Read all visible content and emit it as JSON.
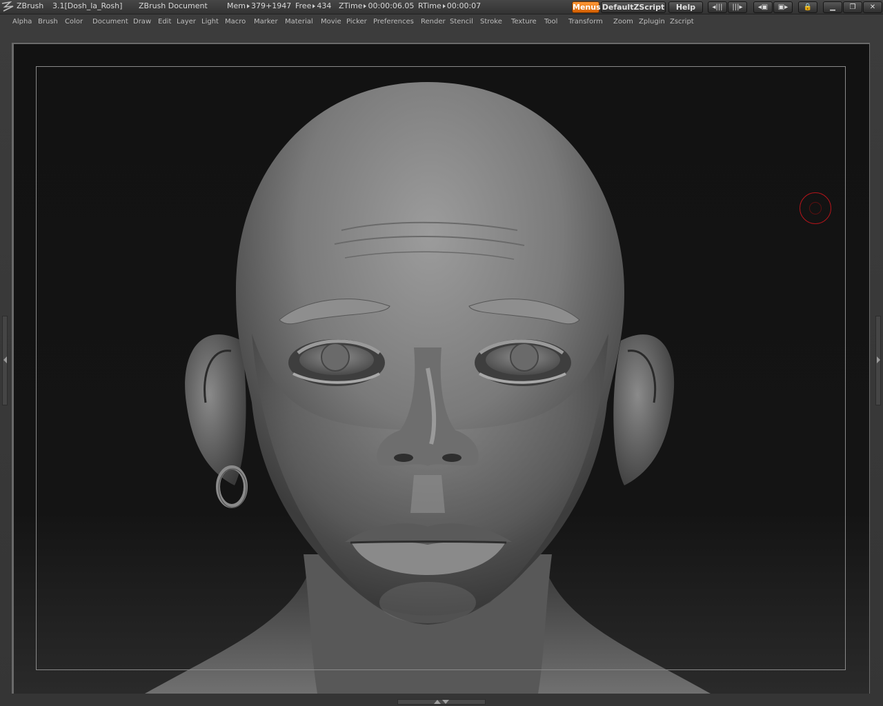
{
  "titlebar": {
    "app_name": "ZBrush",
    "version_and_file": "3.1[Dosh_la_Rosh]",
    "document_label": "ZBrush Document",
    "mem_label": "Mem",
    "mem_value": "379+1947",
    "free_label": "Free",
    "free_value": "434",
    "ztime_label": "ZTime",
    "ztime_value": "00:00:06.05",
    "rtime_label": "RTime",
    "rtime_value": "00:00:07",
    "menus_button": "Menus",
    "script_button": "DefaultZScript",
    "help_button": "Help"
  },
  "menubar": {
    "items": [
      "Alpha",
      "Brush",
      "Color",
      "Document",
      "Draw",
      "Edit",
      "Layer",
      "Light",
      "Macro",
      "Marker",
      "Material",
      "Movie",
      "Picker",
      "Preferences",
      "Render",
      "Stencil",
      "Stroke",
      "Texture",
      "Tool",
      "Transform",
      "Zoom",
      "Zplugin",
      "Zscript"
    ]
  },
  "icons": {
    "logo": "zbrush-logo-icon",
    "brush_cursor": "brush-circle-cursor-icon"
  },
  "colors": {
    "accent": "#e87a1a",
    "cursor": "#b0141a",
    "canvas_bg": "#131313"
  }
}
